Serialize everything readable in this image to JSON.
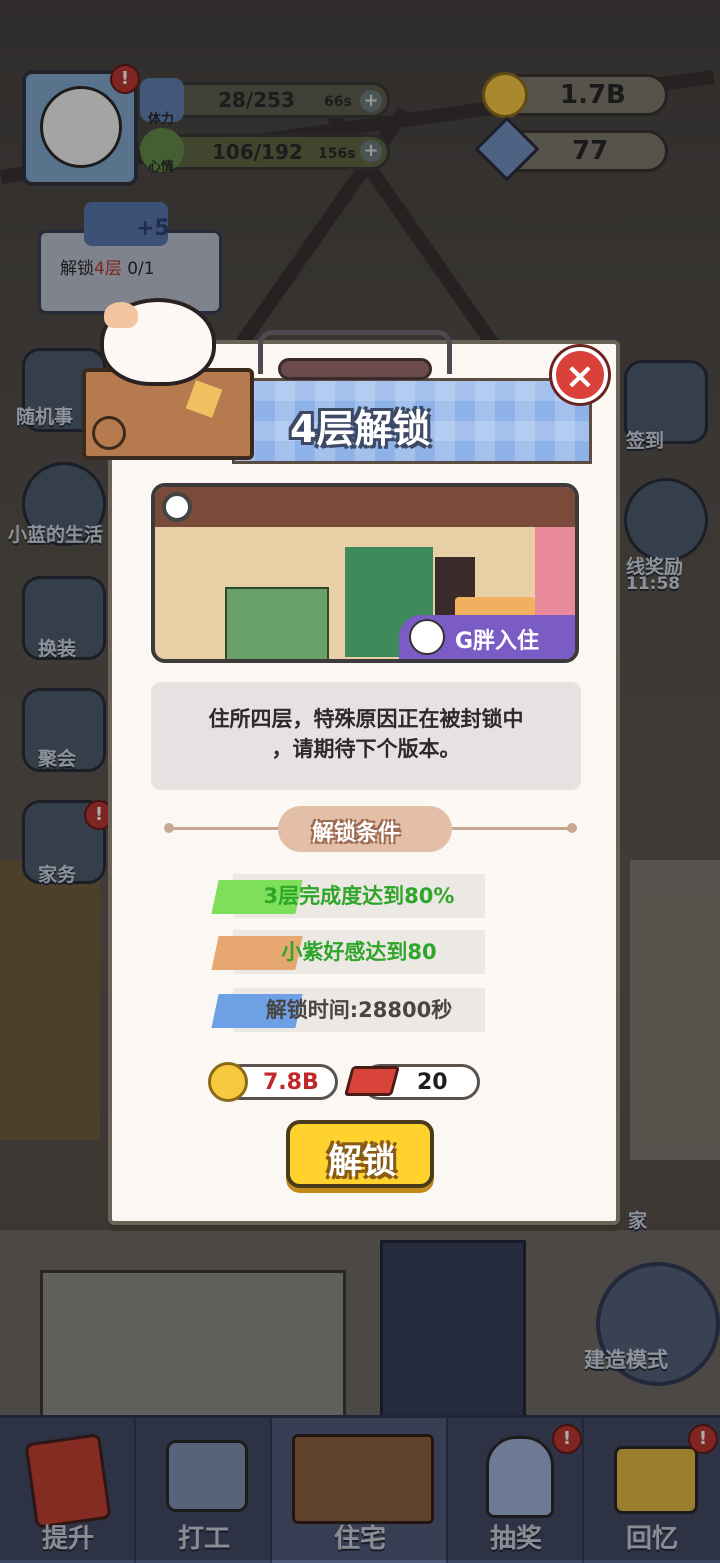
{
  "hud": {
    "stamina_label": "体力",
    "stamina_value": "28/253",
    "stamina_timer": "66s",
    "mood_label": "心情",
    "mood_value": "106/192",
    "mood_timer": "156s",
    "coins": "1.7B",
    "gems": "77",
    "alert": "!"
  },
  "quest": {
    "reward": "+5",
    "text_prefix": "解锁",
    "text_highlight": "4层",
    "text_progress": "0/1"
  },
  "side_left": [
    "随机事",
    "小蓝的生活",
    "换装",
    "聚会",
    "家务"
  ],
  "side_right": [
    "签到",
    "线奖励",
    "11:58",
    "家",
    "建造模式"
  ],
  "dialog": {
    "title": "4层解锁",
    "close": "×",
    "tenant": "G胖入住",
    "description_line1": "住所四层，特殊原因正在被封锁中",
    "description_line2": "，请期待下个版本。",
    "conditions_header": "解锁条件",
    "conditions": [
      {
        "text": "3层完成度达到80%",
        "color": "#2fa52a",
        "tape": "#7ee05a"
      },
      {
        "text": "小紫好感达到80",
        "color": "#2fa52a",
        "tape": "#e7a770"
      },
      {
        "text": "解锁时间:28800秒",
        "color": "#4a4545",
        "tape": "#6ea0e6"
      }
    ],
    "cost_coins": "7.8B",
    "cost_bricks": "20",
    "unlock_label": "解锁"
  },
  "nav": [
    "提升",
    "打工",
    "住宅",
    "抽奖",
    "回忆"
  ],
  "colors": {
    "accent": "#ffd22e",
    "danger": "#d9413a",
    "tenant": "#7b5cc4"
  }
}
